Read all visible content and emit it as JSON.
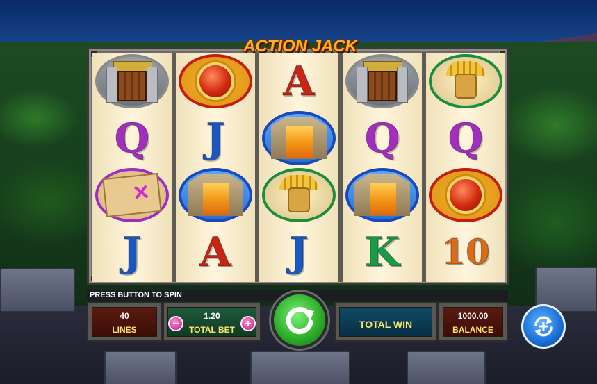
{
  "game": {
    "logo_text": "ACTION JACK"
  },
  "message": "PRESS BUTTON TO SPIN",
  "reels": [
    [
      "temple-door",
      "red-gem",
      "A",
      "temple-door",
      "golden-mask"
    ],
    [
      "Q",
      "J",
      "waterfall",
      "Q",
      "Q"
    ],
    [
      "treasure-map",
      "waterfall",
      "golden-mask",
      "waterfall",
      "red-gem"
    ],
    [
      "J",
      "A",
      "J",
      "K",
      "10"
    ]
  ],
  "hud": {
    "lines_value": "40",
    "lines_label": "LINES",
    "bet_value": "1.20",
    "bet_label": "TOTAL BET",
    "decrease_label": "−",
    "increase_label": "+",
    "win_label": "TOTAL WIN",
    "balance_value": "1000.00",
    "balance_label": "BALANCE"
  },
  "icons": {
    "spin": "circular-arrow-icon",
    "autoplay": "autoplay-icon"
  },
  "colors": {
    "spin_button": "#2fb02a",
    "autoplay_button": "#1a6ed6",
    "label_yellow": "#ffe46a"
  }
}
